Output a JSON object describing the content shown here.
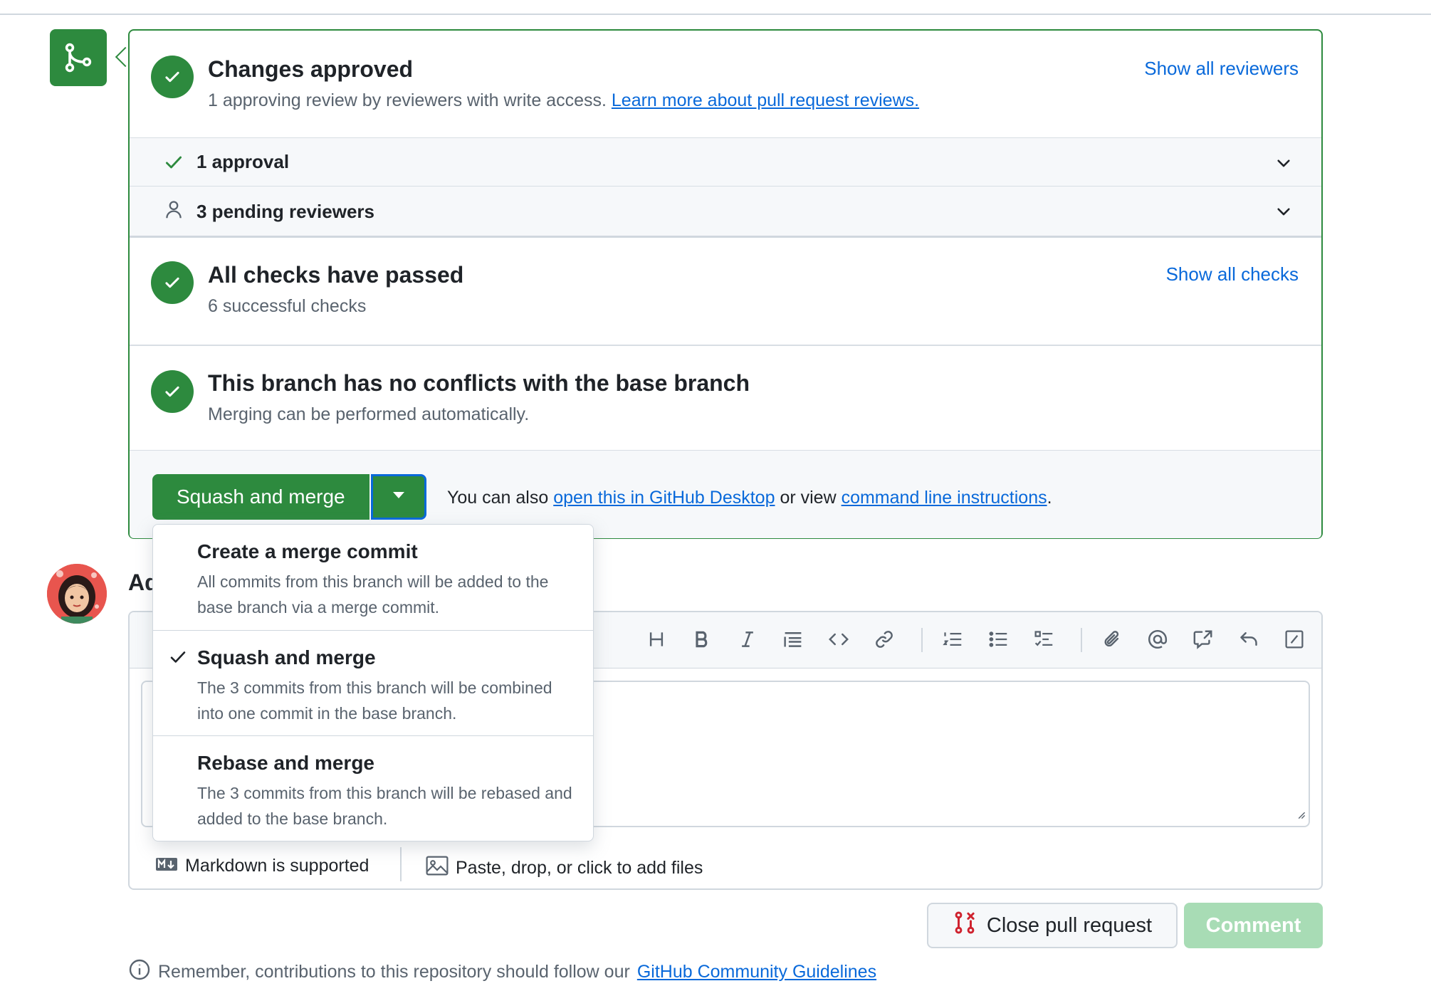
{
  "review": {
    "title": "Changes approved",
    "subtitle_prefix": "1 approving review by reviewers with write access.",
    "learn_more": "Learn more about pull request reviews.",
    "show_all_reviewers": "Show all reviewers",
    "approvals_label": "1 approval",
    "pending_label": "3 pending reviewers"
  },
  "checks": {
    "title": "All checks have passed",
    "subtitle": "6 successful checks",
    "show_all_checks": "Show all checks"
  },
  "conflicts": {
    "title": "This branch has no conflicts with the base branch",
    "subtitle": "Merging can be performed automatically."
  },
  "merge": {
    "button_label": "Squash and merge",
    "also_prefix": "You can also",
    "desktop_link": "open this in GitHub Desktop",
    "or_view": "or view",
    "cli_link": "command line instructions",
    "period": "."
  },
  "dropdown": {
    "options": [
      {
        "title": "Create a merge commit",
        "desc": "All commits from this branch will be added to the base branch via a merge commit.",
        "selected": false
      },
      {
        "title": "Squash and merge",
        "desc": "The 3 commits from this branch will be combined into one commit in the base branch.",
        "selected": true
      },
      {
        "title": "Rebase and merge",
        "desc": "The 3 commits from this branch will be rebased and added to the base branch.",
        "selected": false
      }
    ]
  },
  "comment": {
    "heading_visible": "Ad",
    "markdown_label": "Markdown is supported",
    "attach_label": "Paste, drop, or click to add files",
    "close_button": "Close pull request",
    "comment_button": "Comment",
    "remember_prefix": "Remember, contributions to this repository should follow our",
    "guidelines_link": "GitHub Community Guidelines"
  },
  "colors": {
    "success": "#2d8a3e",
    "link": "#0969da",
    "danger": "#cf222e",
    "comment_disabled": "#a8dcb5"
  }
}
